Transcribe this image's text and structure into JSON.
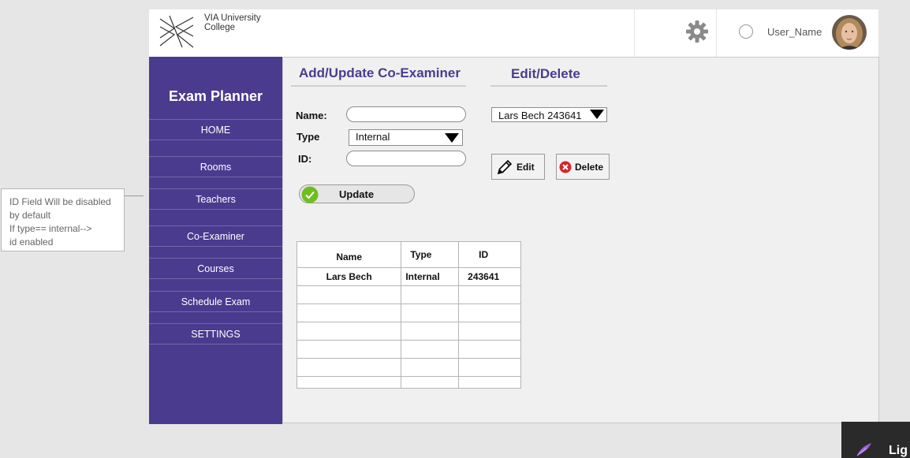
{
  "header": {
    "logo_line1": "VIA University",
    "logo_line2": "College",
    "settings_icon": "gear-icon",
    "username": "User_Name"
  },
  "sidebar": {
    "app_title": "Exam Planner",
    "items": [
      {
        "label": "HOME"
      },
      {
        "label": "Rooms"
      },
      {
        "label": "Teachers"
      },
      {
        "label": "Co-Examiner"
      },
      {
        "label": "Courses"
      },
      {
        "label": "Schedule Exam"
      },
      {
        "label": "SETTINGS"
      }
    ]
  },
  "form": {
    "title": "Add/Update Co-Examiner",
    "name_label": "Name:",
    "name_value": "",
    "type_label": "Type",
    "type_selected": "Internal",
    "id_label": "ID:",
    "id_value": "",
    "update_label": "Update"
  },
  "edit_panel": {
    "title": "Edit/Delete",
    "selected_examiner": "Lars Bech 243641",
    "edit_label": "Edit",
    "delete_label": "Delete"
  },
  "table": {
    "headers": [
      "Name",
      "Type",
      "ID"
    ],
    "rows": [
      [
        "Lars Bech",
        "Internal",
        "243641"
      ],
      [
        "",
        "",
        ""
      ],
      [
        "",
        "",
        ""
      ],
      [
        "",
        "",
        ""
      ],
      [
        "",
        "",
        ""
      ],
      [
        "",
        "",
        ""
      ],
      [
        "",
        "",
        ""
      ]
    ]
  },
  "note": {
    "lines": [
      "ID Field Will be disabled",
      "by default",
      "If type== internal-->",
      "id enabled"
    ]
  },
  "taskbar": {
    "text": "Lig"
  },
  "colors": {
    "sidebar_bg": "#4b3b8f",
    "accent_title": "#4b3b8f",
    "update_check": "#6fbe1f",
    "delete_red": "#d6262b"
  }
}
